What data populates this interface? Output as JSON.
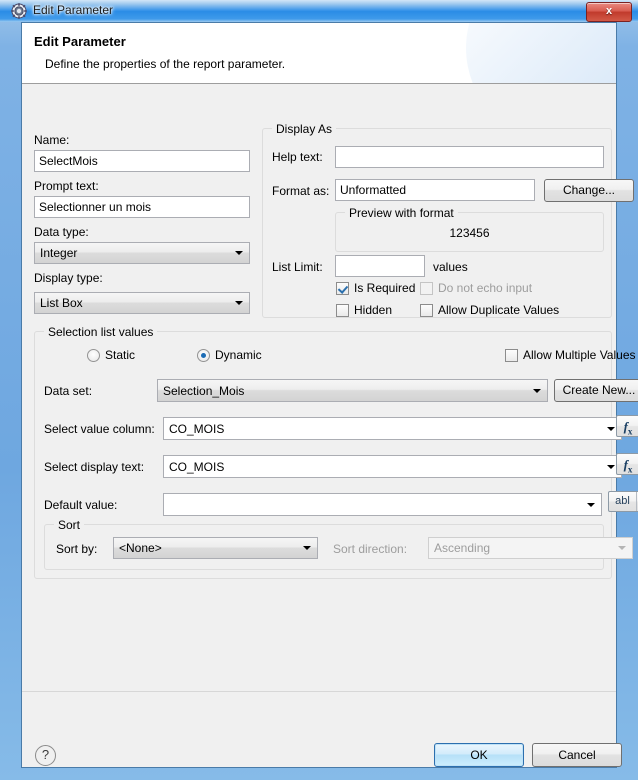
{
  "window": {
    "title": "Edit Parameter",
    "icon": "gear-icon",
    "close_label": "x"
  },
  "header": {
    "title": "Edit Parameter",
    "subtitle": "Define the properties of the report parameter."
  },
  "form": {
    "name_label": "Name:",
    "name_value": "SelectMois",
    "prompt_label": "Prompt text:",
    "prompt_value": "Selectionner un mois",
    "data_type_label": "Data type:",
    "data_type_value": "Integer",
    "display_type_label": "Display type:",
    "display_type_value": "List Box"
  },
  "display_as": {
    "group_title": "Display As",
    "help_text_label": "Help text:",
    "help_text_value": "",
    "format_as_label": "Format as:",
    "format_as_value": "Unformatted",
    "change_button": "Change...",
    "preview_group_title": "Preview with format",
    "preview_value": "123456",
    "list_limit_label": "List Limit:",
    "list_limit_value": "",
    "values_label": "values",
    "is_required_label": "Is Required",
    "is_required_checked": true,
    "do_not_echo_label": "Do not echo input",
    "do_not_echo_checked": false,
    "do_not_echo_disabled": true,
    "hidden_label": "Hidden",
    "hidden_checked": false,
    "allow_duplicate_label": "Allow Duplicate Values",
    "allow_duplicate_checked": false
  },
  "selection_list": {
    "group_title": "Selection list values",
    "static_label": "Static",
    "dynamic_label": "Dynamic",
    "selected_mode": "Dynamic",
    "allow_multiple_label": "Allow Multiple Values",
    "allow_multiple_checked": false,
    "data_set_label": "Data set:",
    "data_set_value": "Selection_Mois",
    "create_new_button": "Create New...",
    "select_value_column_label": "Select value column:",
    "select_value_column_value": "CO_MOIS",
    "select_display_text_label": "Select display text:",
    "select_display_text_value": "CO_MOIS",
    "default_value_label": "Default value:",
    "default_value_value": "",
    "fx_button_label": "fx",
    "abl_button_label": "abl"
  },
  "sort": {
    "group_title": "Sort",
    "sort_by_label": "Sort by:",
    "sort_by_value": "<None>",
    "sort_direction_label": "Sort direction:",
    "sort_direction_value": "Ascending",
    "sort_direction_disabled": true
  },
  "footer": {
    "help_icon_label": "?",
    "ok_button": "OK",
    "cancel_button": "Cancel"
  },
  "colors": {
    "titlebar_accent": "#2a8ce6",
    "close_button": "#c03a2c",
    "accent_check": "#2a6fad",
    "radio_dot": "#1c6cb5",
    "default_button_border": "#2c6fae"
  }
}
